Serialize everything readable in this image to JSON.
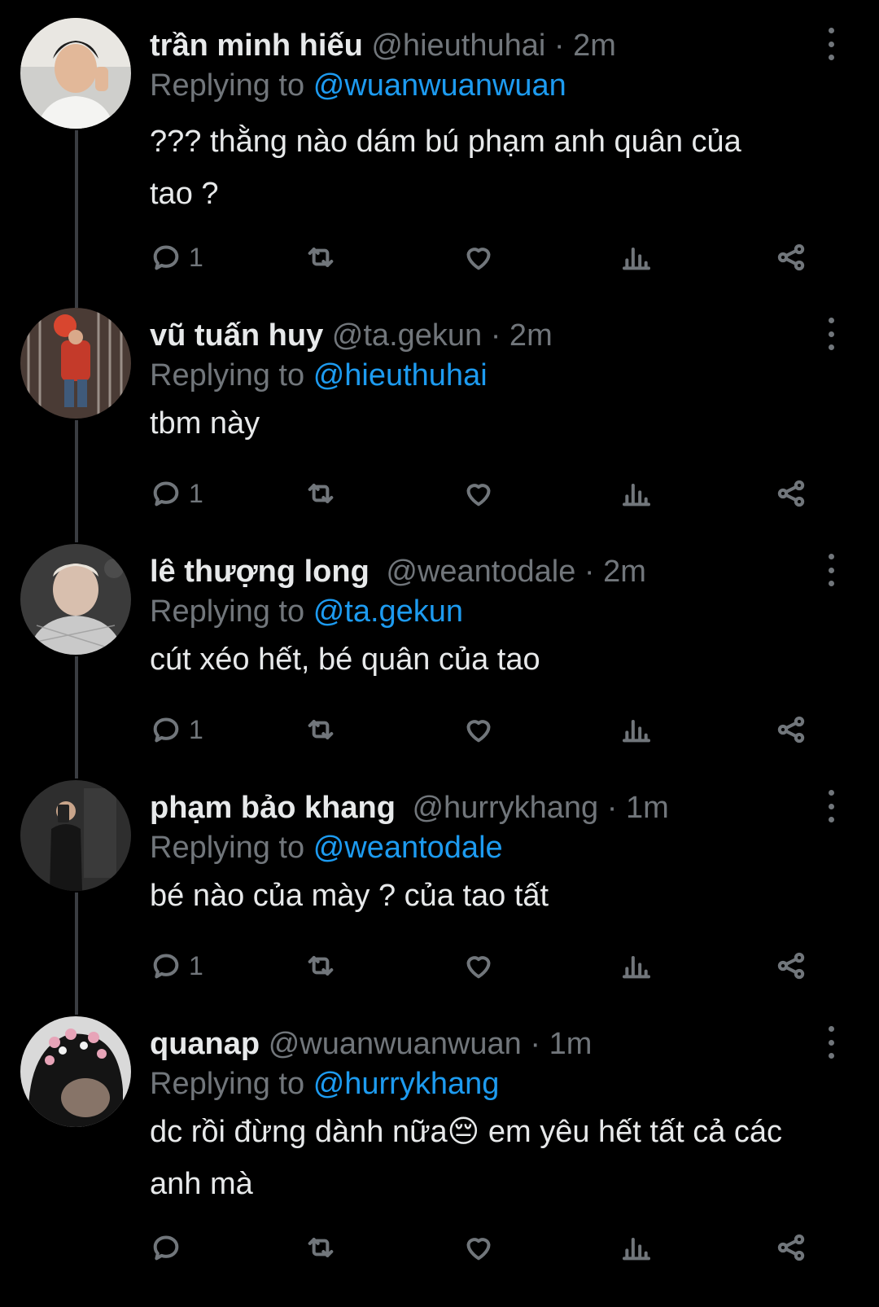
{
  "colors": {
    "background": "#000000",
    "text": "#e7e9ea",
    "muted": "#71767b",
    "accent": "#1d9bf0"
  },
  "tweets": [
    {
      "name": "trần minh hiếu",
      "handle": "@hieuthuhai",
      "time": "· 2m",
      "replying_label": "Replying to",
      "replying_to": "@wuanwuanwuan",
      "text": "??? thằng nào dám bú phạm anh quân của tao ?",
      "reply_count": "1"
    },
    {
      "name": "vũ tuấn huy",
      "handle": "@ta.gekun",
      "time": "· 2m",
      "replying_label": "Replying to",
      "replying_to": "@hieuthuhai",
      "text": "tbm này",
      "reply_count": "1"
    },
    {
      "name": "lê thượng long",
      "handle": "@weantodale",
      "time": "· 2m",
      "replying_label": "Replying to",
      "replying_to": "@ta.gekun",
      "text": "cút xéo hết, bé quân của tao",
      "reply_count": "1"
    },
    {
      "name": "phạm bảo khang",
      "handle": "@hurrykhang",
      "time": "· 1m",
      "replying_label": "Replying to",
      "replying_to": "@weantodale",
      "text": "bé nào của mày ? của tao tất",
      "reply_count": "1"
    },
    {
      "name": "quanap",
      "handle": "@wuanwuanwuan",
      "time": "· 1m",
      "replying_label": "Replying to",
      "replying_to": "@hurrykhang",
      "text": "dc rồi đừng dành nữa😔 em yêu hết tất cả các anh mà",
      "reply_count": ""
    }
  ],
  "icons": {
    "reply": "reply-icon",
    "retweet": "retweet-icon",
    "like": "heart-icon",
    "views": "views-icon",
    "share": "share-icon",
    "more": "more-vertical-icon"
  }
}
